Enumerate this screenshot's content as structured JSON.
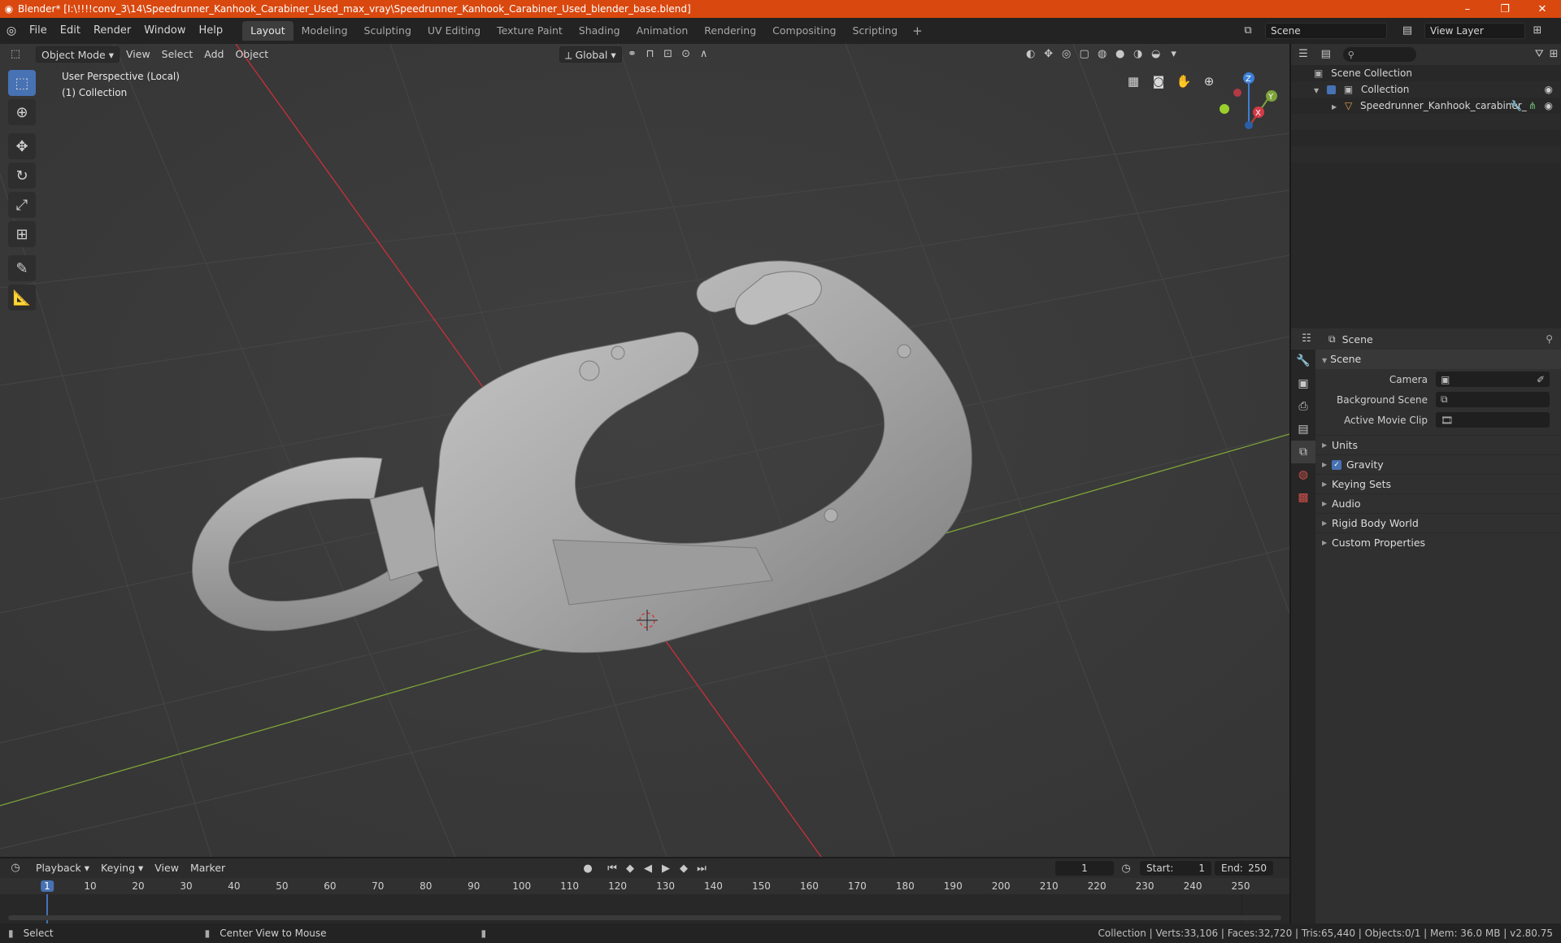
{
  "window": {
    "title": "Blender* [I:\\!!!!conv_3\\14\\Speedrunner_Kanhook_Carabiner_Used_max_vray\\Speedrunner_Kanhook_Carabiner_Used_blender_base.blend]",
    "minimize": "–",
    "maximize": "❐",
    "close": "✕"
  },
  "menus": [
    "File",
    "Edit",
    "Render",
    "Window",
    "Help"
  ],
  "workspaces": [
    "Layout",
    "Modeling",
    "Sculpting",
    "UV Editing",
    "Texture Paint",
    "Shading",
    "Animation",
    "Rendering",
    "Compositing",
    "Scripting"
  ],
  "workspace_add": "+",
  "scene_name": "Scene",
  "view_layer": "View Layer",
  "viewport": {
    "mode": "Object Mode",
    "menus": [
      "View",
      "Select",
      "Add",
      "Object"
    ],
    "transform_orientation": "Global",
    "info_line1": "User Perspective (Local)",
    "info_line2": "(1) Collection",
    "gizmo_axes": {
      "x": "X",
      "y": "Y",
      "z": "Z"
    }
  },
  "outliner": {
    "root": "Scene Collection",
    "collection": "Collection",
    "object": "Speedrunner_Kanhook_carabiner_"
  },
  "properties": {
    "header": "Scene",
    "panel": "Scene",
    "camera_label": "Camera",
    "background_label": "Background Scene",
    "movie_clip_label": "Active Movie Clip",
    "subpanels": [
      "Units",
      "Gravity",
      "Keying Sets",
      "Audio",
      "Rigid Body World",
      "Custom Properties"
    ]
  },
  "timeline": {
    "menus": [
      "Playback",
      "Keying",
      "View",
      "Marker"
    ],
    "current_frame": "1",
    "start_label": "Start:",
    "start_value": "1",
    "end_label": "End:",
    "end_value": "250",
    "ticks": [
      "1",
      "10",
      "20",
      "30",
      "40",
      "50",
      "60",
      "70",
      "80",
      "90",
      "100",
      "110",
      "120",
      "130",
      "140",
      "150",
      "160",
      "170",
      "180",
      "190",
      "200",
      "210",
      "220",
      "230",
      "240",
      "250"
    ]
  },
  "statusbar": {
    "select": "Select",
    "center": "Center View to Mouse",
    "stats": "Collection | Verts:33,106 | Faces:32,720 | Tris:65,440 | Objects:0/1 | Mem: 36.0 MB | v2.80.75"
  },
  "colors": {
    "titlebar": "#d9480f",
    "accent": "#4772b3",
    "viewport_bg": "#3b3b3b",
    "x_axis": "#c9303a",
    "y_axis": "#7ea33a"
  }
}
